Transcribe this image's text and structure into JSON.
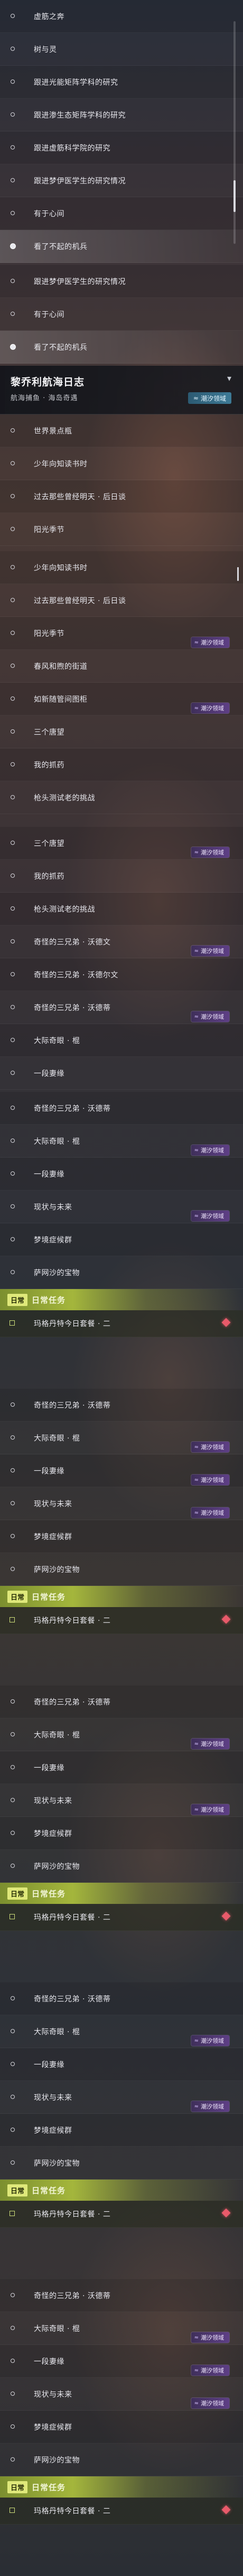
{
  "panel1": {
    "rows": [
      {
        "label": "虚筋之奔"
      },
      {
        "label": "树与灵"
      },
      {
        "label": "跟进光能矩阵学科的研究"
      },
      {
        "label": "跟进渗生态矩阵学科的研究"
      },
      {
        "label": "跟进虚筋科学院的研究"
      },
      {
        "label": "跟进梦伊医学生的研究情况"
      },
      {
        "label": "有于心间"
      },
      {
        "label": "看了不起的机兵",
        "selected": true
      }
    ]
  },
  "panel2": {
    "rows": [
      {
        "label": "跟进梦伊医学生的研究情况"
      },
      {
        "label": "有于心间"
      },
      {
        "label": "看了不起的机兵",
        "selected": true
      }
    ]
  },
  "journal": {
    "title": "黎乔利航海日志",
    "subtitle": "航海捕鱼 · 海岛奇遇",
    "badge": "潮汐领域"
  },
  "panel3": {
    "rows": [
      {
        "label": "世界景点瓶"
      },
      {
        "label": "少年向知读书时"
      },
      {
        "label": "过去那些曾经明天 · 后日谈"
      },
      {
        "label": "阳光季节"
      }
    ]
  },
  "panel4": {
    "rows": [
      {
        "label": "少年向知读书时"
      },
      {
        "label": "过去那些曾经明天 · 后日谈"
      },
      {
        "label": "阳光季节",
        "chip": "潮汐领域"
      },
      {
        "label": "春风和煦的街道"
      },
      {
        "label": "如新随管间图柜",
        "chip": "潮汐领域"
      },
      {
        "label": "三个唐望"
      },
      {
        "label": "我的抓药"
      },
      {
        "label": "枪头测试老的挑战"
      }
    ]
  },
  "panel5": {
    "rows": [
      {
        "label": "三个唐望",
        "chip": "潮汐领域"
      },
      {
        "label": "我的抓药"
      },
      {
        "label": "枪头测试老的挑战"
      },
      {
        "label": "奇怪的三兄弟 · 沃德文",
        "chip": "潮汐领域"
      },
      {
        "label": "奇怪的三兄弟 · 沃德尔文"
      },
      {
        "label": "奇怪的三兄弟 · 沃德蒂",
        "chip": "潮汐领域"
      },
      {
        "label": "大际奇眼 · 棍"
      },
      {
        "label": "一段妻缘"
      }
    ]
  },
  "cycles": [
    {
      "rows": [
        {
          "label": "奇怪的三兄弟 · 沃德蒂"
        },
        {
          "label": "大际奇眼 · 棍",
          "chip": "潮汐领域"
        },
        {
          "label": "一段妻缘"
        },
        {
          "label": "现状与未来",
          "chip": "潮汐领域"
        },
        {
          "label": "梦境症候群"
        },
        {
          "label": "萨网沙的宝物"
        }
      ],
      "task_tag": "日常",
      "task_title": "日常任务",
      "task_item": "玛格丹特今日套餐 · 二"
    },
    {
      "rows": [
        {
          "label": "奇怪的三兄弟 · 沃德蒂"
        },
        {
          "label": "大际奇眼 · 棍",
          "chip": "潮汐领域"
        },
        {
          "label": "一段妻缘",
          "chip": "潮汐领域"
        },
        {
          "label": "现状与未来",
          "chip": "潮汐领域"
        },
        {
          "label": "梦境症候群"
        },
        {
          "label": "萨网沙的宝物"
        }
      ],
      "task_tag": "日常",
      "task_title": "日常任务",
      "task_item": "玛格丹特今日套餐 · 二"
    },
    {
      "rows": [
        {
          "label": "奇怪的三兄弟 · 沃德蒂"
        },
        {
          "label": "大际奇眼 · 棍",
          "chip": "潮汐领域"
        },
        {
          "label": "一段妻缘"
        },
        {
          "label": "现状与未来",
          "chip": "潮汐领域"
        },
        {
          "label": "梦境症候群"
        },
        {
          "label": "萨网沙的宝物"
        }
      ],
      "task_tag": "日常",
      "task_title": "日常任务",
      "task_item": "玛格丹特今日套餐 · 二"
    },
    {
      "rows": [
        {
          "label": "奇怪的三兄弟 · 沃德蒂"
        },
        {
          "label": "大际奇眼 · 棍",
          "chip": "潮汐领域"
        },
        {
          "label": "一段妻缘"
        },
        {
          "label": "现状与未来",
          "chip": "潮汐领域"
        },
        {
          "label": "梦境症候群"
        },
        {
          "label": "萨网沙的宝物"
        }
      ],
      "task_tag": "日常",
      "task_title": "日常任务",
      "task_item": "玛格丹特今日套餐 · 二"
    },
    {
      "rows": [
        {
          "label": "奇怪的三兄弟 · 沃德蒂"
        },
        {
          "label": "大际奇眼 · 棍",
          "chip": "潮汐领域"
        },
        {
          "label": "一段妻缘",
          "chip": "潮汐领域"
        },
        {
          "label": "现状与未来",
          "chip": "潮汐领域"
        },
        {
          "label": "梦境症候群"
        },
        {
          "label": "萨网沙的宝物"
        }
      ],
      "task_tag": "日常",
      "task_title": "日常任务",
      "task_item": "玛格丹特今日套餐 · 二"
    }
  ]
}
